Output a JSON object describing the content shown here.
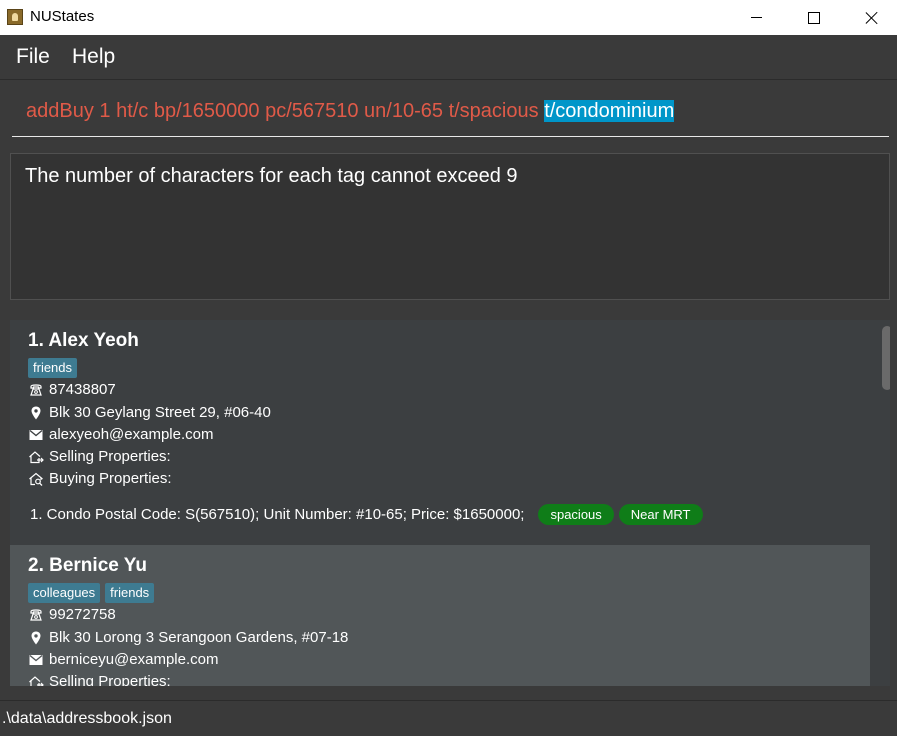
{
  "window": {
    "title": "NUStates"
  },
  "menu": {
    "file": "File",
    "help": "Help"
  },
  "command": {
    "text_unselected": "addBuy 1 ht/c bp/1650000 pc/567510 un/10-65 t/spacious ",
    "text_selected": "t/condominium"
  },
  "result": {
    "message": "The number of characters for each tag cannot exceed 9"
  },
  "persons": [
    {
      "name": "1. Alex Yeoh",
      "tags": [
        "friends"
      ],
      "phone": "87438807",
      "address": "Blk 30 Geylang Street 29, #06-40",
      "email": "alexyeoh@example.com",
      "selling_label": "Selling Properties:",
      "buying_label": "Buying Properties:",
      "property": {
        "text": "1. Condo Postal Code: S(567510);  Unit Number: #10-65;  Price: $1650000;",
        "tags": [
          "spacious",
          "Near MRT"
        ]
      }
    },
    {
      "name": "2. Bernice Yu",
      "tags": [
        "colleagues",
        "friends"
      ],
      "phone": "99272758",
      "address": "Blk 30 Lorong 3 Serangoon Gardens, #07-18",
      "email": "berniceyu@example.com",
      "selling_label": "Selling Properties:"
    }
  ],
  "status": {
    "path": ".\\data\\addressbook.json"
  },
  "colors": {
    "error_text": "#e05a48",
    "selection": "#0096c9",
    "tag_bg": "#3e7b91",
    "property_tag_bg": "#0f7d18"
  }
}
